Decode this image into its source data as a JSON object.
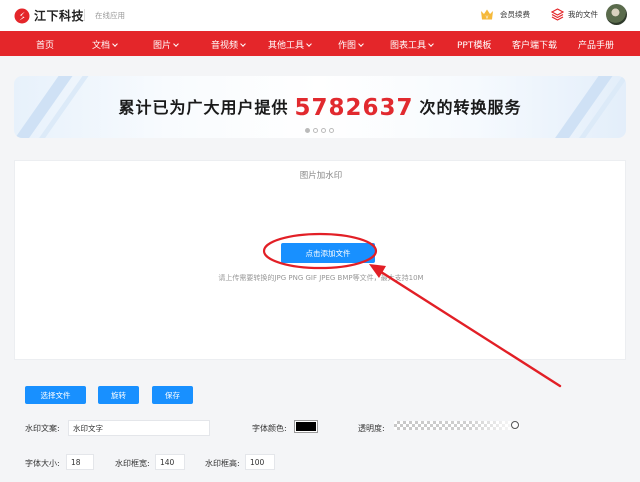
{
  "header": {
    "logo_text": "江下科技",
    "tagline": "在线应用",
    "vip_label": "会员续费",
    "my_files_label": "我的文件"
  },
  "nav": {
    "items": [
      {
        "label": "首页",
        "dropdown": false
      },
      {
        "label": "文档",
        "dropdown": true
      },
      {
        "label": "图片",
        "dropdown": true
      },
      {
        "label": "音视频",
        "dropdown": true
      },
      {
        "label": "其他工具",
        "dropdown": true
      },
      {
        "label": "作图",
        "dropdown": true
      },
      {
        "label": "图表工具",
        "dropdown": true
      },
      {
        "label": "PPT模板",
        "dropdown": false
      },
      {
        "label": "客户端下载",
        "dropdown": false
      },
      {
        "label": "产品手册",
        "dropdown": false
      }
    ]
  },
  "banner": {
    "prefix": "累计已为广大用户提供",
    "count": "5782637",
    "suffix": "次的转换服务",
    "slide_count": 4,
    "active_slide": 0
  },
  "upload": {
    "title": "图片加水印",
    "add_button": "点击添加文件",
    "hint": "请上传需要转换的JPG PNG GIF JPEG BMP等文件，最大支持10M"
  },
  "actions": {
    "select_file": "选择文件",
    "rotate": "旋转",
    "save": "保存"
  },
  "settings": {
    "watermark_text_label": "水印文案:",
    "watermark_text_value": "水印文字",
    "font_color_label": "字体颜色:",
    "font_color_value": "#000000",
    "opacity_label": "透明度:",
    "opacity_value": 1.0,
    "font_size_label": "字体大小:",
    "font_size_value": "18",
    "box_width_label": "水印框宽:",
    "box_width_value": "140",
    "box_height_label": "水印框高:",
    "box_height_value": "100"
  },
  "colors": {
    "brand_red": "#e4262a",
    "primary_blue": "#1890ff",
    "annotation_red": "#e21f26"
  }
}
